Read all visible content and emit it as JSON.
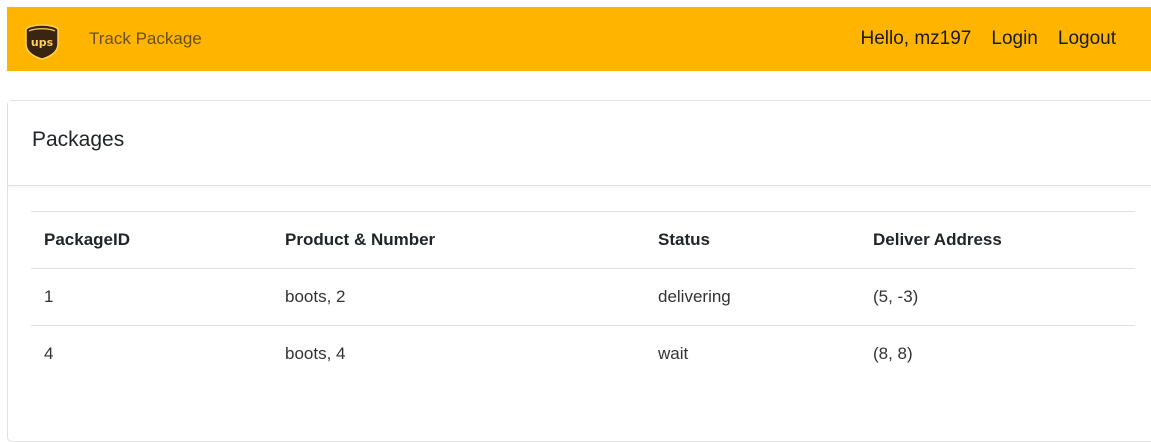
{
  "navbar": {
    "brand_label": "Track Package",
    "greeting": "Hello, mz197",
    "login_label": "Login",
    "logout_label": "Logout",
    "background_color": "#ffb500"
  },
  "logo": {
    "icon": "ups-shield-logo",
    "text": "ups"
  },
  "card": {
    "title": "Packages"
  },
  "table": {
    "columns": [
      "PackageID",
      "Product & Number",
      "Status",
      "Deliver Address"
    ],
    "rows": [
      [
        "1",
        "boots, 2",
        "delivering",
        "(5, -3)"
      ],
      [
        "4",
        "boots, 4",
        "wait",
        "(8, 8)"
      ]
    ]
  }
}
